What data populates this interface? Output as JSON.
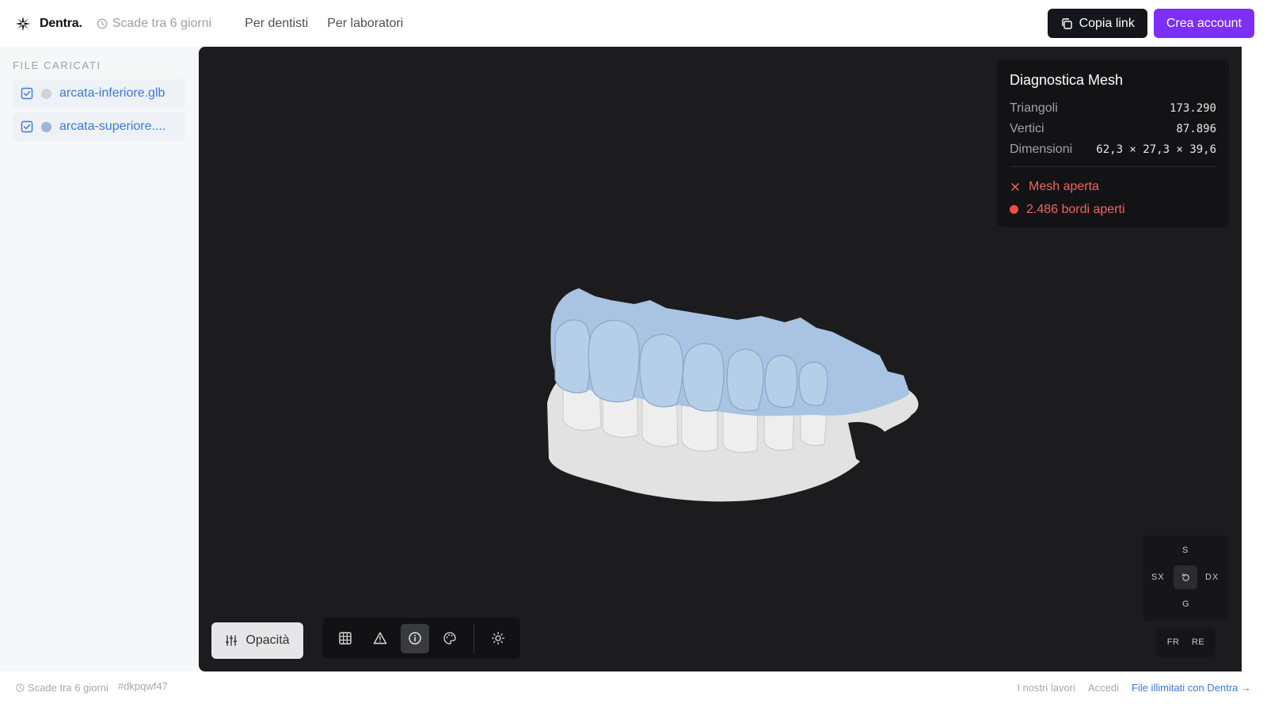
{
  "header": {
    "brand": "Dentra.",
    "expiry": "Scade tra 6 giorni",
    "nav": [
      "Per dentisti",
      "Per laboratori"
    ],
    "copy_link_label": "Copia link",
    "create_account_label": "Crea account"
  },
  "sidebar": {
    "title": "FILE CARICATI",
    "files": [
      {
        "name": "arcata-inferiore.glb",
        "color": "#cfd3d8",
        "checked": true
      },
      {
        "name": "arcata-superiore....",
        "color": "#9fb6d1",
        "checked": true
      }
    ]
  },
  "diagnostics": {
    "title": "Diagnostica Mesh",
    "rows": [
      {
        "label": "Triangoli",
        "value": "173.290"
      },
      {
        "label": "Vertici",
        "value": "87.896"
      },
      {
        "label": "Dimensioni",
        "value": "62,3 × 27,3 × 39,6"
      }
    ],
    "status_open": "Mesh aperta",
    "status_edges": "2.486 bordi aperti"
  },
  "viewer": {
    "opacity_label": "Opacità",
    "tools": [
      "grid-icon",
      "warning-icon",
      "info-icon",
      "palette-icon",
      "sun-icon"
    ],
    "compass": {
      "top": "S",
      "left": "SX",
      "right": "DX",
      "bottom": "G"
    },
    "views": [
      "FR",
      "RE"
    ],
    "colors": {
      "upper_arch": "#a8c4e2",
      "lower_arch": "#e4e4e4",
      "background": "#1c1c1e"
    }
  },
  "footer": {
    "expiry": "Scade tra 6 giorni",
    "id": "#dkpqwf47",
    "links": [
      "I nostri lavori",
      "Accedi"
    ],
    "cta": "File illimitati con Dentra →"
  },
  "colors": {
    "accent_purple": "#7b2ff7",
    "link_blue": "#3a7bd5",
    "error_red": "#f26363"
  }
}
